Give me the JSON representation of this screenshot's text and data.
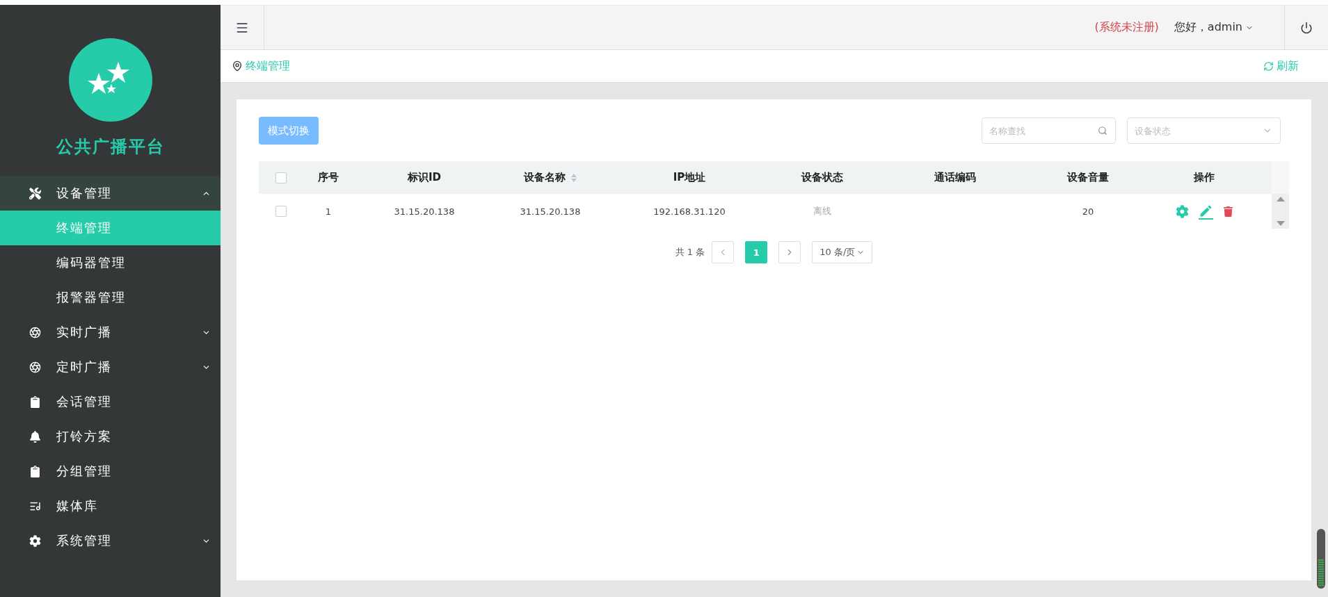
{
  "sidebar": {
    "title": "公共广播平台",
    "items": [
      {
        "label": "设备管理",
        "expanded": true,
        "selected": false,
        "children": [
          {
            "label": "终端管理",
            "selected": true
          },
          {
            "label": "编码器管理",
            "selected": false
          },
          {
            "label": "报警器管理",
            "selected": false
          }
        ]
      },
      {
        "label": "实时广播",
        "expanded": false,
        "selected": false
      },
      {
        "label": "定时广播",
        "expanded": false,
        "selected": false
      },
      {
        "label": "会话管理",
        "selected": false
      },
      {
        "label": "打铃方案",
        "selected": false
      },
      {
        "label": "分组管理",
        "selected": false
      },
      {
        "label": "媒体库",
        "selected": false
      },
      {
        "label": "系统管理",
        "expanded": false,
        "selected": false
      }
    ]
  },
  "header": {
    "notice": "(系统未注册)",
    "greeting": "您好，admin"
  },
  "breadcrumb": {
    "current": "终端管理",
    "refresh": "刷新"
  },
  "toolbar": {
    "mode_button": "模式切换",
    "search": {
      "placeholder": "名称查找"
    },
    "status_select": {
      "placeholder": "设备状态"
    }
  },
  "table": {
    "header_checked": false,
    "columns": [
      {
        "label": "序号",
        "sortable": false
      },
      {
        "label": "标识ID",
        "sortable": false
      },
      {
        "label": "设备名称",
        "sortable": true
      },
      {
        "label": "IP地址",
        "sortable": false
      },
      {
        "label": "设备状态",
        "sortable": false
      },
      {
        "label": "通话编码",
        "sortable": false
      },
      {
        "label": "设备音量",
        "sortable": false
      },
      {
        "label": "操作",
        "sortable": false
      }
    ],
    "rows": [
      {
        "checked": false,
        "cells": [
          "1",
          "31.15.20.138",
          "31.15.20.138",
          "192.168.31.120",
          "离线",
          "",
          "20"
        ],
        "online": false
      }
    ]
  },
  "pagination": {
    "total": "共 1 条",
    "pages": [
      {
        "label": "1",
        "selected": true
      }
    ],
    "page_size": "10 条/页"
  }
}
